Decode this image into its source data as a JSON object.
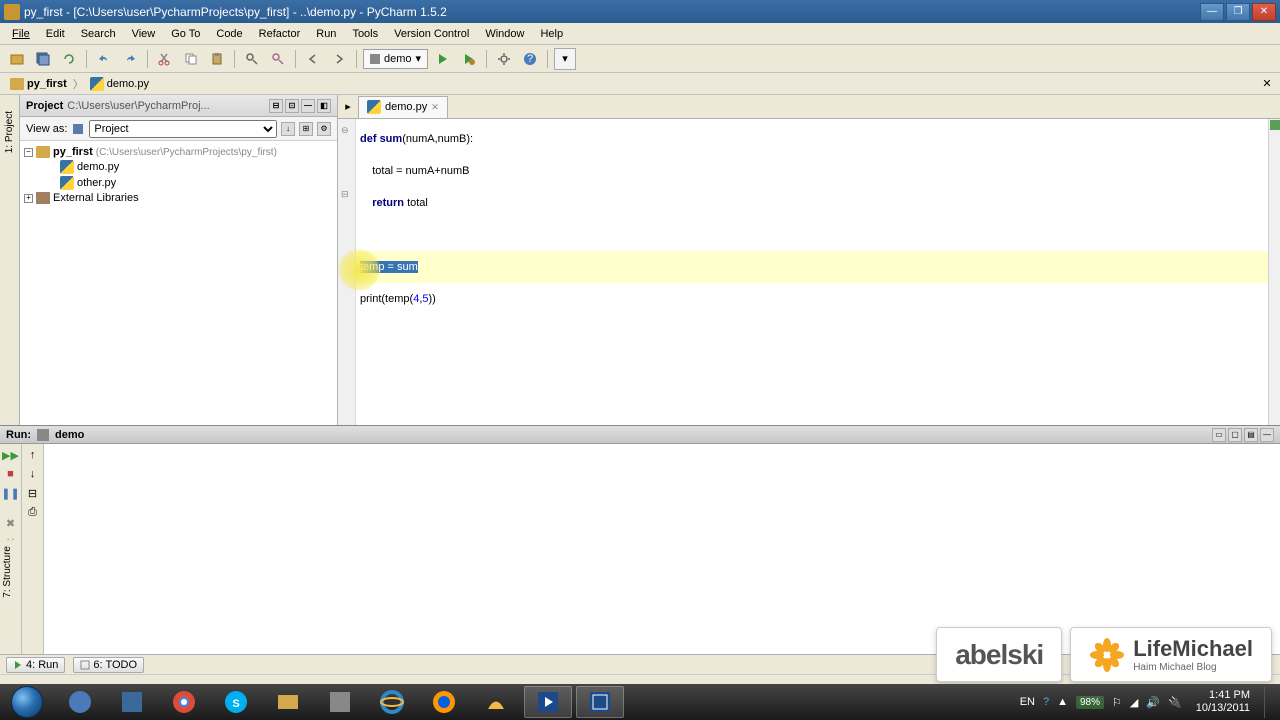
{
  "titlebar": {
    "text": "py_first - [C:\\Users\\user\\PycharmProjects\\py_first] - ..\\demo.py - PyCharm 1.5.2"
  },
  "menubar": {
    "items": [
      "File",
      "Edit",
      "Search",
      "View",
      "Go To",
      "Code",
      "Refactor",
      "Run",
      "Tools",
      "Version Control",
      "Window",
      "Help"
    ]
  },
  "toolbar": {
    "run_config": "demo"
  },
  "breadcrumb": {
    "project": "py_first",
    "file": "demo.py"
  },
  "project_panel": {
    "title": "Project",
    "path": "C:\\Users\\user\\PycharmProj...",
    "view_as_label": "View as:",
    "view_as_value": "Project",
    "tree": {
      "root": "py_first",
      "root_path": "(C:\\Users\\user\\PycharmProjects\\py_first)",
      "files": [
        "demo.py",
        "other.py"
      ],
      "external": "External Libraries"
    }
  },
  "editor": {
    "tab_name": "demo.py",
    "code": {
      "line1_def": "def ",
      "line1_fn": "sum",
      "line1_rest": "(numA,numB):",
      "line2": "    total = numA+numB",
      "line3_kw": "    return ",
      "line3_rest": "total",
      "line5_sel": "temp = sum",
      "line6_pre": "print(temp(",
      "line6_arg1": "4",
      "line6_comma": ",",
      "line6_arg2": "5",
      "line6_post": "))"
    }
  },
  "run_panel": {
    "title": "Run:",
    "name": "demo"
  },
  "statusbar": {
    "run_label": "4: Run",
    "todo_label": "6: TODO"
  },
  "watermarks": {
    "abelski": "abelski",
    "life_title": "LifeMichael",
    "life_sub": "Haim Michael Blog"
  },
  "tray": {
    "lang": "EN",
    "battery": "98%",
    "time": "1:41 PM",
    "date": "10/13/2011"
  },
  "left_tabs": {
    "project": "1: Project"
  },
  "structure_tab": "7: Structure"
}
